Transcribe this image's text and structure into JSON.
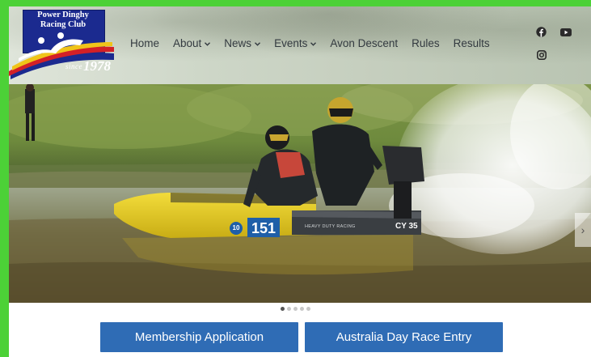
{
  "logo": {
    "line1": "Power Dinghy",
    "line2": "Racing Club",
    "since": "since",
    "year": "1978"
  },
  "nav": {
    "items": [
      {
        "label": "Home",
        "dropdown": false
      },
      {
        "label": "About",
        "dropdown": true
      },
      {
        "label": "News",
        "dropdown": true
      },
      {
        "label": "Events",
        "dropdown": true
      },
      {
        "label": "Avon Descent",
        "dropdown": false
      },
      {
        "label": "Rules",
        "dropdown": false
      },
      {
        "label": "Results",
        "dropdown": false
      }
    ],
    "caret": "⌄"
  },
  "social": {
    "icons": [
      "facebook-icon",
      "youtube-icon",
      "instagram-icon"
    ]
  },
  "hero": {
    "boat_number": "151",
    "boat_badge": "10",
    "boat_side_text": "HEAVY DUTY RACING",
    "boat_rego": "CY 35",
    "next_arrow": "›"
  },
  "carousel": {
    "slides": 5,
    "active": 1
  },
  "buttons": {
    "membership": "Membership Application",
    "race_entry": "Australia Day Race Entry"
  },
  "colors": {
    "page_border": "#4cd137",
    "logo_blue": "#1b2a8f",
    "button_blue": "#2f6cb5",
    "boat_yellow": "#e8cf2a"
  }
}
